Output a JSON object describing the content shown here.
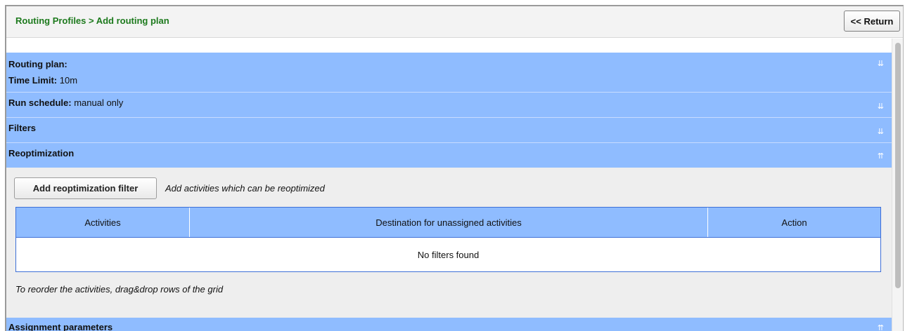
{
  "header": {
    "breadcrumb": "Routing Profiles > Add routing plan",
    "return_label": "<< Return"
  },
  "sections": {
    "routing_plan": {
      "title": "Routing plan:",
      "time_limit_label": "Time Limit:",
      "time_limit_value": "10m"
    },
    "run_schedule": {
      "label": "Run schedule:",
      "value": "manual only"
    },
    "filters": {
      "title": "Filters"
    },
    "reoptimization": {
      "title": "Reoptimization"
    },
    "assignment": {
      "title": "Assignment parameters"
    }
  },
  "reopt": {
    "add_button_label": "Add reoptimization filter",
    "hint": "Add activities which can be reoptimized",
    "grid": {
      "columns": [
        "Activities",
        "Destination for unassigned activities",
        "Action"
      ],
      "empty_text": "No filters found"
    },
    "reorder_hint": "To reorder the activities, drag&drop rows of the grid"
  },
  "icons": {
    "expand": "double-chevron-down-icon",
    "collapse": "double-chevron-up-icon"
  },
  "colors": {
    "section_bg": "#8fbcff",
    "breadcrumb": "#1d7a1d",
    "grid_border": "#3e6fd6"
  }
}
